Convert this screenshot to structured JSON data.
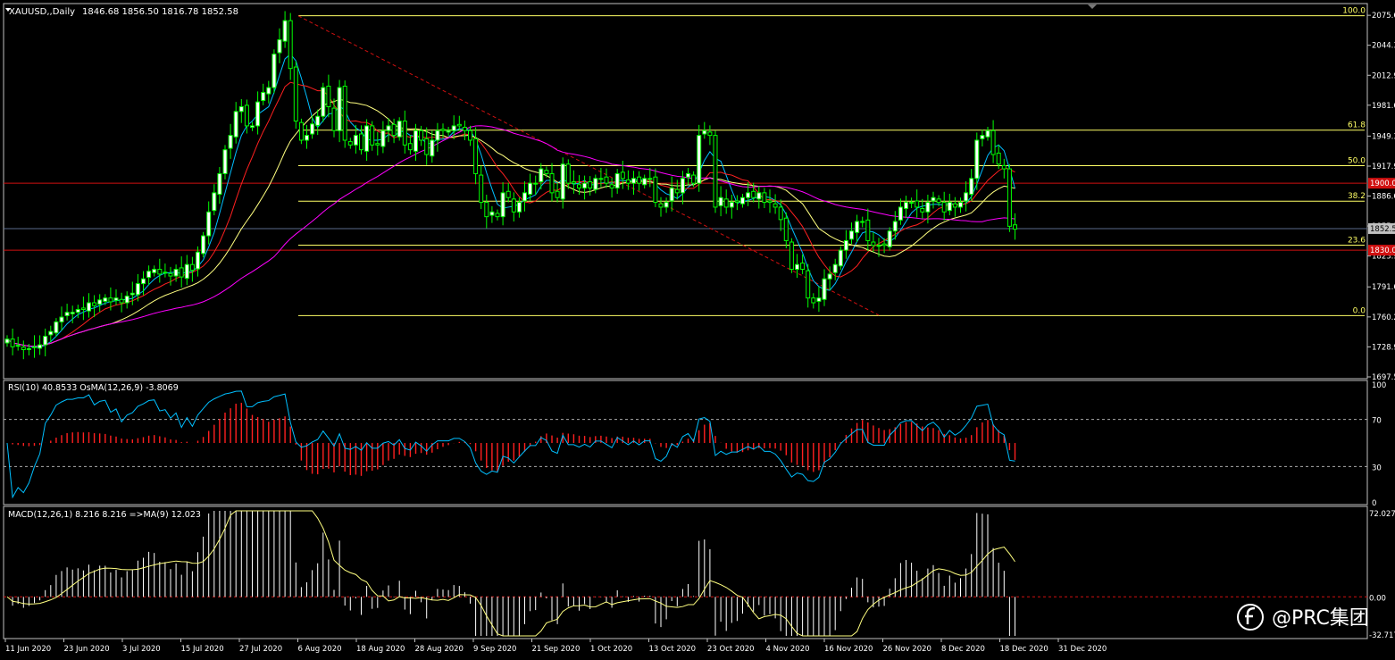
{
  "window": {
    "symbol_header": "XAUUSD,,Daily",
    "ohlc_header": "1846.68 1856.50 1816.78 1852.58"
  },
  "watermark": {
    "text": "@PRC集团"
  },
  "colors": {
    "background": "#000000",
    "frame": "#c0c0c0",
    "bull_candle": "#00ff00",
    "bull_body": "#ffffff",
    "bear_candle": "#00ff00",
    "ma_fast": "#00bfff",
    "ma_mid": "#ff2020",
    "ma_slow": "#ffff80",
    "ma_long": "#ff00ff",
    "fib_line": "#ffff66",
    "level_line": "#d01010",
    "trend_line": "#d01010",
    "rsi_line": "#00bfff",
    "osma_bar": "#ff2020",
    "macd_hist": "#ffffff",
    "macd_signal": "#ffff80"
  },
  "chart_data": [
    {
      "type": "candlestick",
      "panel": "price",
      "symbol": "XAUUSD",
      "timeframe": "Daily",
      "y_ticks": [
        "2075.6",
        "2044.3",
        "2012.9",
        "1981.6",
        "1949.3",
        "1917.9",
        "1886.6",
        "1855.3",
        "1823.9",
        "1791.6",
        "1760.2",
        "1728.9",
        "1697.5"
      ],
      "ylim": [
        1697.5,
        2086
      ],
      "current_price": {
        "value": 1852.58,
        "label": "1852.5"
      },
      "horizontal_levels": [
        {
          "value": 1900,
          "label": "1900.0"
        },
        {
          "value": 1830,
          "label": "1830.0"
        }
      ],
      "fibonacci": [
        {
          "level": "100.0",
          "price": 2075.1
        },
        {
          "level": "61.8",
          "price": 1955.5
        },
        {
          "level": "50.0",
          "price": 1918.4
        },
        {
          "level": "38.2",
          "price": 1881.3
        },
        {
          "level": "23.6",
          "price": 1835.3
        },
        {
          "level": "0.0",
          "price": 1761.6
        }
      ],
      "x_labels": [
        "11 Jun 2020",
        "23 Jun 2020",
        "3 Jul 2020",
        "15 Jul 2020",
        "27 Jul 2020",
        "6 Aug 2020",
        "18 Aug 2020",
        "28 Aug 2020",
        "9 Sep 2020",
        "21 Sep 2020",
        "1 Oct 2020",
        "13 Oct 2020",
        "23 Oct 2020",
        "4 Nov 2020",
        "16 Nov 2020",
        "26 Nov 2020",
        "8 Dec 2020",
        "18 Dec 2020",
        "31 Dec 2020"
      ],
      "close": [
        1737,
        1729,
        1730,
        1726,
        1727,
        1729,
        1731,
        1740,
        1745,
        1755,
        1760,
        1765,
        1765,
        1768,
        1768,
        1775,
        1772,
        1778,
        1780,
        1776,
        1780,
        1775,
        1782,
        1785,
        1795,
        1800,
        1808,
        1810,
        1805,
        1807,
        1803,
        1810,
        1802,
        1815,
        1809,
        1828,
        1845,
        1870,
        1890,
        1910,
        1935,
        1950,
        1975,
        1980,
        1960,
        1960,
        1985,
        1995,
        2000,
        2035,
        2050,
        2070,
        2020,
        1965,
        1945,
        1950,
        1962,
        1970,
        2000,
        1980,
        1955,
        2000,
        1945,
        1940,
        1950,
        1935,
        1960,
        1940,
        1940,
        1955,
        1960,
        1950,
        1965,
        1940,
        1935,
        1955,
        1945,
        1930,
        1945,
        1955,
        1955,
        1955,
        1960,
        1960,
        1955,
        1945,
        1910,
        1880,
        1865,
        1870,
        1865,
        1890,
        1885,
        1870,
        1880,
        1890,
        1900,
        1900,
        1915,
        1910,
        1890,
        1885,
        1920,
        1900,
        1900,
        1895,
        1900,
        1895,
        1905,
        1905,
        1900,
        1895,
        1910,
        1905,
        1900,
        1905,
        1900,
        1905,
        1905,
        1880,
        1875,
        1880,
        1895,
        1890,
        1905,
        1910,
        1900,
        1950,
        1955,
        1950,
        1875,
        1885,
        1875,
        1880,
        1880,
        1885,
        1890,
        1885,
        1890,
        1880,
        1880,
        1875,
        1862,
        1840,
        1810,
        1815,
        1810,
        1780,
        1775,
        1780,
        1800,
        1805,
        1815,
        1830,
        1840,
        1850,
        1860,
        1860,
        1840,
        1835,
        1835,
        1835,
        1850,
        1860,
        1875,
        1880,
        1880,
        1875,
        1870,
        1880,
        1885,
        1880,
        1870,
        1880,
        1875,
        1880,
        1890,
        1905,
        1945,
        1950,
        1955,
        1930,
        1920,
        1915,
        1855,
        1852
      ]
    },
    {
      "type": "line+bar",
      "panel": "rsi",
      "title": "RSI(10) 40.8533 OsMA(12,26,9) -3.8069",
      "y_ticks": [
        "100",
        "70",
        "30",
        "0"
      ],
      "ylim": [
        0,
        100
      ],
      "levels": [
        70,
        30
      ],
      "rsi_last": 40.8533,
      "osma_last": -3.8069
    },
    {
      "type": "histogram+line",
      "panel": "macd",
      "title": "MACD(12,26,1) 8.216 8.216 =>MA(9) 12.023",
      "y_ticks": [
        "72.027",
        "0.00",
        "-32.717"
      ],
      "ylim": [
        -32.717,
        72.027
      ],
      "macd_last": 8.216,
      "signal_last": 12.023
    }
  ]
}
